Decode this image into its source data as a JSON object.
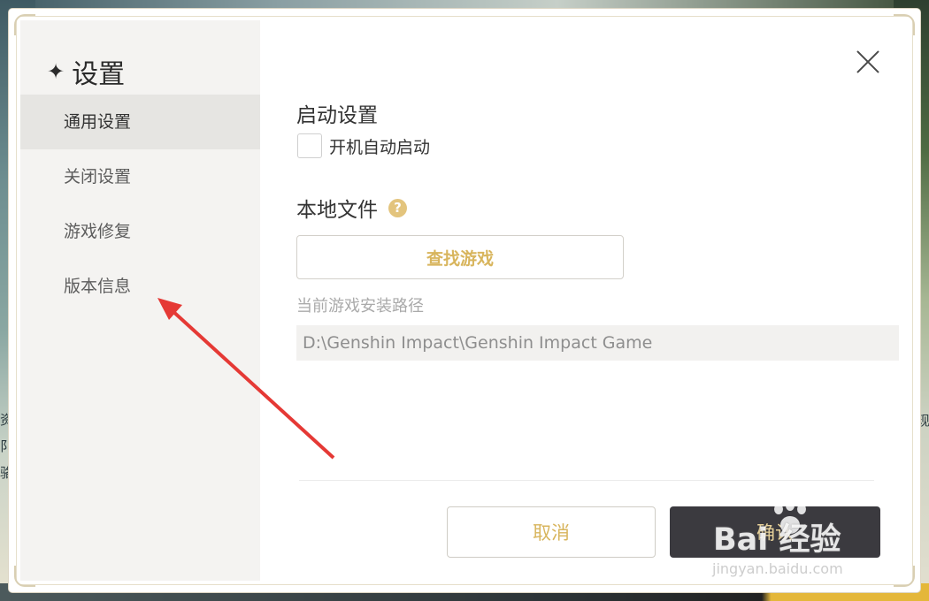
{
  "dialog": {
    "title": "设置",
    "title_icon": "sparkle-star-icon",
    "close_icon": "close-icon"
  },
  "sidebar": {
    "items": [
      {
        "label": "通用设置",
        "active": true
      },
      {
        "label": "关闭设置",
        "active": false
      },
      {
        "label": "游戏修复",
        "active": false
      },
      {
        "label": "版本信息",
        "active": false
      }
    ]
  },
  "launch": {
    "section_title": "启动设置",
    "autostart_label": "开机自动启动",
    "autostart_checked": false
  },
  "local_files": {
    "section_title": "本地文件",
    "help_icon": "question-mark-icon",
    "help_glyph": "?",
    "find_button": "查找游戏",
    "path_label": "当前游戏安装路径",
    "path_value": "D:\\Genshin Impact\\Genshin Impact Game"
  },
  "footer": {
    "cancel_label": "取消",
    "confirm_label": "确认"
  },
  "background": {
    "left_chars": "资\n阝\n骆",
    "right_chars": "现"
  },
  "watermark": {
    "text": "Bai 经验",
    "url": "jingyan.baidu.com"
  },
  "colors": {
    "accent": "#d8b55d",
    "annotation_arrow": "#e53935",
    "confirm_bg": "#3b3a3f"
  }
}
